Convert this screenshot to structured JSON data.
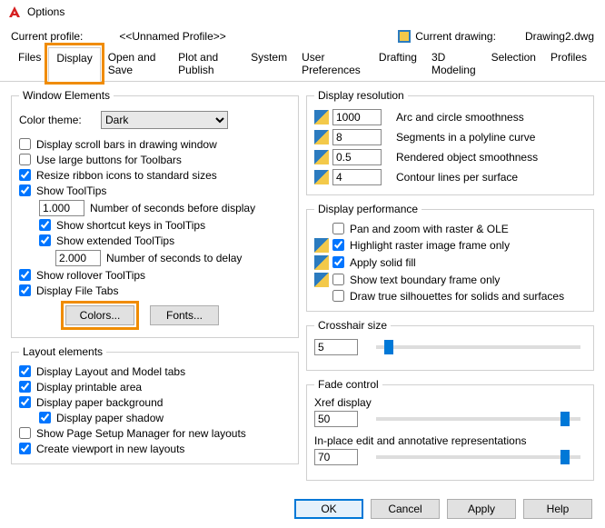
{
  "title": "Options",
  "profile_label": "Current profile:",
  "profile_value": "<<Unnamed Profile>>",
  "drawing_label": "Current drawing:",
  "drawing_value": "Drawing2.dwg",
  "tabs": {
    "files": "Files",
    "display": "Display",
    "open_save": "Open and Save",
    "plot": "Plot and Publish",
    "system": "System",
    "userpref": "User Preferences",
    "drafting": "Drafting",
    "threed": "3D Modeling",
    "selection": "Selection",
    "profiles": "Profiles"
  },
  "win": {
    "legend": "Window Elements",
    "color_theme_label": "Color theme:",
    "color_theme_value": "Dark",
    "scrollbars": "Display scroll bars in drawing window",
    "large_buttons": "Use large buttons for Toolbars",
    "resize_ribbon": "Resize ribbon icons to standard sizes",
    "show_tooltips": "Show ToolTips",
    "tooltip_secs_value": "1.000",
    "tooltip_secs_label": "Number of seconds before display",
    "shortcut_keys": "Show shortcut keys in ToolTips",
    "extended_tt": "Show extended ToolTips",
    "delay_value": "2.000",
    "delay_label": "Number of seconds to delay",
    "rollover": "Show rollover ToolTips",
    "filetabs": "Display File Tabs",
    "colors_btn": "Colors...",
    "fonts_btn": "Fonts..."
  },
  "layout": {
    "legend": "Layout elements",
    "model_tabs": "Display Layout and Model tabs",
    "printable": "Display printable area",
    "paper_bg": "Display paper background",
    "paper_shadow": "Display paper shadow",
    "page_setup": "Show Page Setup Manager for new layouts",
    "viewport": "Create viewport in new layouts"
  },
  "res": {
    "legend": "Display resolution",
    "r1_val": "1000",
    "r1_lbl": "Arc and circle smoothness",
    "r2_val": "8",
    "r2_lbl": "Segments in a polyline curve",
    "r3_val": "0.5",
    "r3_lbl": "Rendered object smoothness",
    "r4_val": "4",
    "r4_lbl": "Contour lines per surface"
  },
  "perf": {
    "legend": "Display performance",
    "pan_zoom": "Pan and zoom with raster & OLE",
    "highlight_raster": "Highlight raster image frame only",
    "solid_fill": "Apply solid fill",
    "text_boundary": "Show text boundary frame only",
    "true_sil": "Draw true silhouettes for solids and surfaces"
  },
  "xhair": {
    "legend": "Crosshair size",
    "value": "5",
    "pct": 4
  },
  "fade": {
    "legend": "Fade control",
    "xref_label": "Xref display",
    "xref_value": "50",
    "xref_pct": 90,
    "inplace_label": "In-place edit and annotative representations",
    "inplace_value": "70",
    "inplace_pct": 90
  },
  "footer": {
    "ok": "OK",
    "cancel": "Cancel",
    "apply": "Apply",
    "help": "Help"
  }
}
